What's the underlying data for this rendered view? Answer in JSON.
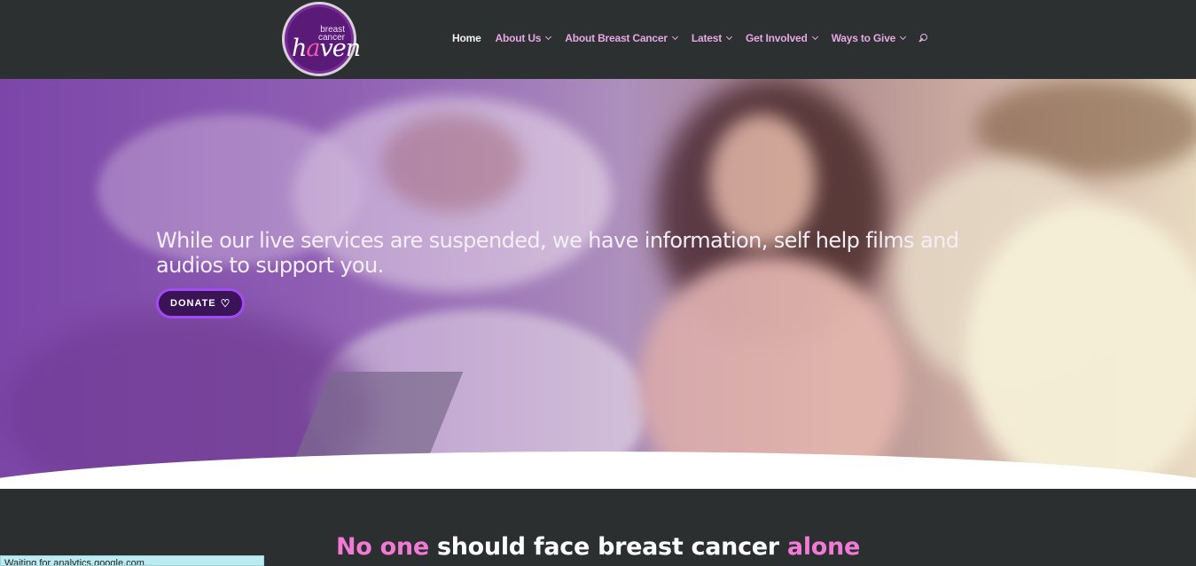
{
  "logo": {
    "top_line": "breast",
    "second_line": "cancer",
    "word_start": "h",
    "word_accent": "a",
    "word_end": "ven"
  },
  "nav": {
    "items": [
      {
        "label": "Home",
        "has_dropdown": false
      },
      {
        "label": "About Us",
        "has_dropdown": true
      },
      {
        "label": "About Breast Cancer",
        "has_dropdown": true
      },
      {
        "label": "Latest",
        "has_dropdown": true
      },
      {
        "label": "Get Involved",
        "has_dropdown": true
      },
      {
        "label": "Ways to Give",
        "has_dropdown": true
      }
    ],
    "search_icon": "search-icon"
  },
  "hero": {
    "headline": "While our live services are suspended, we have information, self help films and audios to support you.",
    "donate_label": "DONATE",
    "donate_icon": "heart-icon"
  },
  "section": {
    "tagline_part1": "No one",
    "tagline_part2": " should face breast cancer ",
    "tagline_part3": "alone"
  },
  "status_bar": {
    "text": "Waiting for analytics.google.com..."
  },
  "colors": {
    "header_bg": "#2c3031",
    "nav_link": "#e7a7e4",
    "accent_purple": "#a24bf5",
    "accent_pink": "#f27ad7"
  }
}
